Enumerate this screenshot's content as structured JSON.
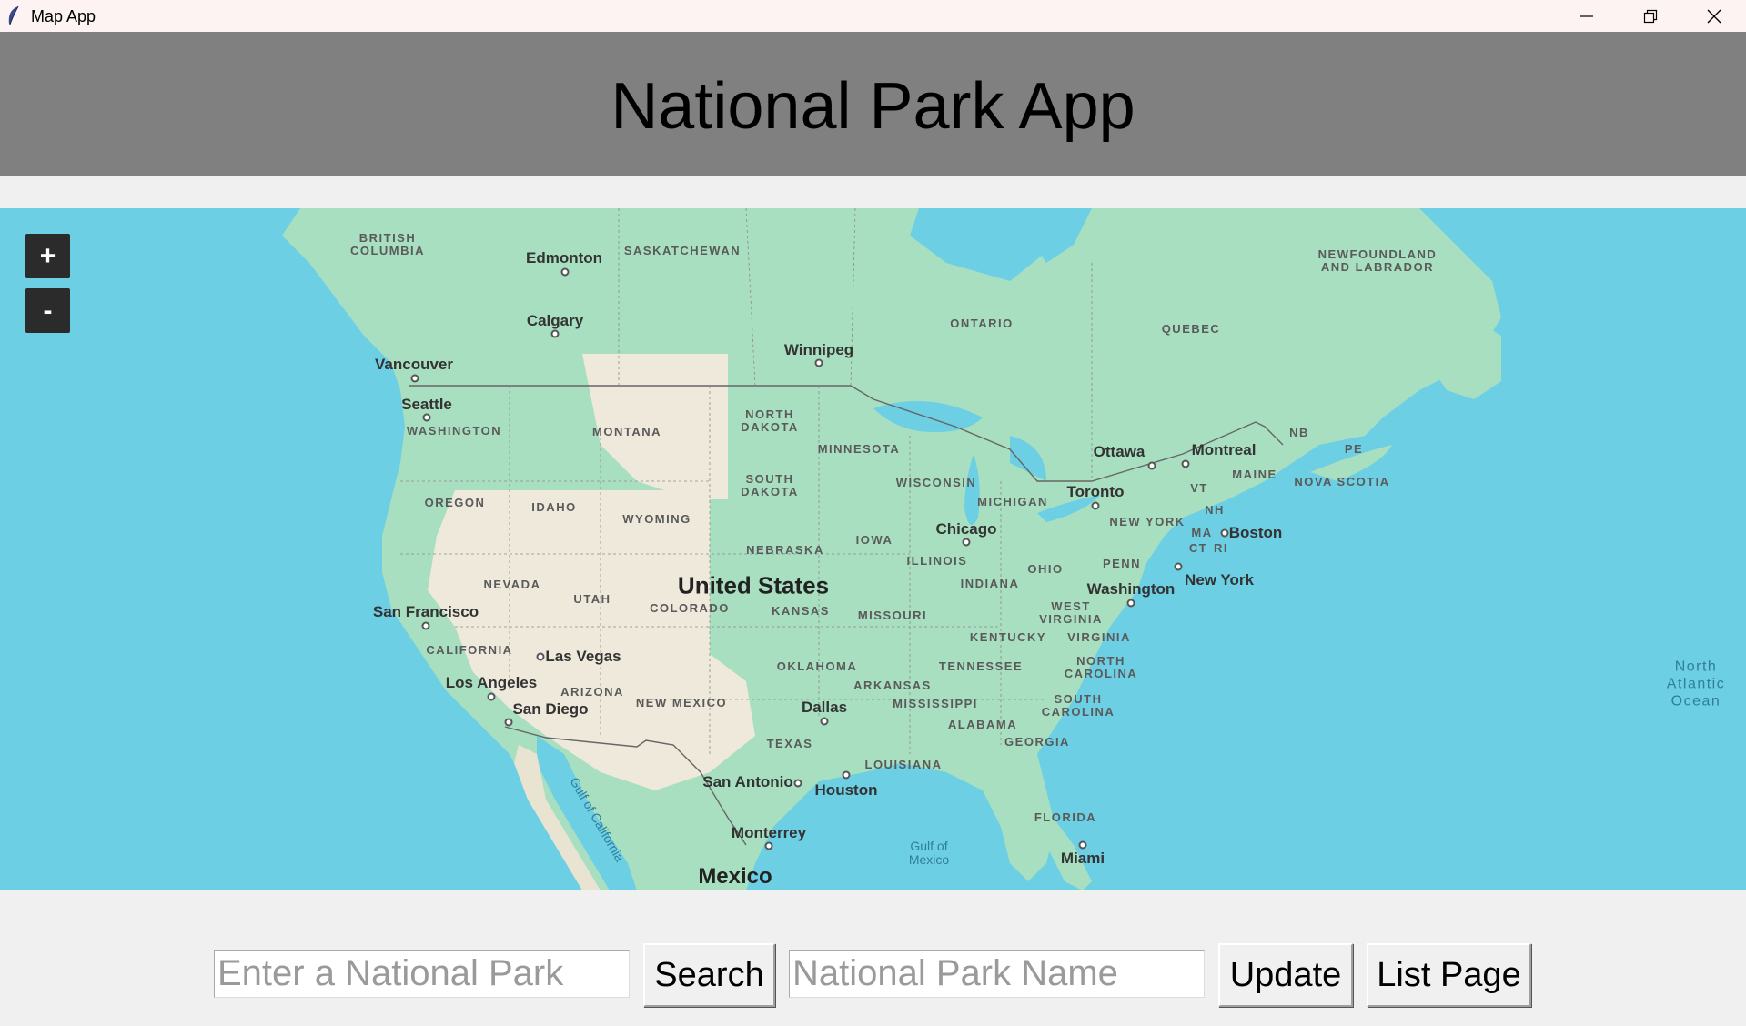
{
  "window": {
    "title": "Map App",
    "controls": [
      "minimize",
      "restore",
      "close"
    ]
  },
  "header": {
    "title": "National Park App",
    "background": "#808080"
  },
  "map": {
    "zoom_in_label": "+",
    "zoom_out_label": "-",
    "labels": {
      "british_columbia": "BRITISH\nCOLUMBIA",
      "edmonton": "Edmonton",
      "saskatchewan": "SASKATCHEWAN",
      "calgary": "Calgary",
      "winnipeg": "Winnipeg",
      "ontario": "ONTARIO",
      "quebec": "QUEBEC",
      "newfoundland": "NEWFOUNDLAND\nAND LABRADOR",
      "vancouver": "Vancouver",
      "seattle": "Seattle",
      "washington": "WASHINGTON",
      "montana": "MONTANA",
      "north_dakota": "NORTH\nDAKOTA",
      "minnesota": "MINNESOTA",
      "ottawa": "Ottawa",
      "montreal": "Montreal",
      "nb": "NB",
      "pe": "PE",
      "oregon": "OREGON",
      "idaho": "IDAHO",
      "south_dakota": "SOUTH\nDAKOTA",
      "wisconsin": "WISCONSIN",
      "michigan": "MICHIGAN",
      "toronto": "Toronto",
      "vt": "VT",
      "maine": "MAINE",
      "nova_scotia": "NOVA SCOTIA",
      "wyoming": "WYOMING",
      "new_york_state": "NEW YORK",
      "nh": "NH",
      "chicago": "Chicago",
      "iowa": "IOWA",
      "nebraska": "NEBRASKA",
      "ma": "MA",
      "boston": "Boston",
      "ct": "CT",
      "ri": "RI",
      "nevada": "NEVADA",
      "illinois": "ILLINOIS",
      "ohio": "OHIO",
      "penn": "PENN",
      "utah": "UTAH",
      "united_states": "United States",
      "indiana": "INDIANA",
      "new_york_city": "New York",
      "washington_dc": "Washington",
      "san_francisco": "San Francisco",
      "colorado": "COLORADO",
      "kansas": "KANSAS",
      "missouri": "MISSOURI",
      "west_virginia": "WEST\nVIRGINIA",
      "kentucky": "KENTUCKY",
      "virginia": "VIRGINIA",
      "california": "CALIFORNIA",
      "las_vegas": "Las Vegas",
      "oklahoma": "OKLAHOMA",
      "tennessee": "TENNESSEE",
      "north_carolina": "NORTH\nCAROLINA",
      "los_angeles": "Los Angeles",
      "arizona": "ARIZONA",
      "arkansas": "ARKANSAS",
      "north_atlantic": "North\nAtlantic\nOcean",
      "san_diego": "San Diego",
      "new_mexico": "NEW MEXICO",
      "dallas": "Dallas",
      "mississippi": "MISSISSIPPI",
      "south_carolina": "SOUTH\nCAROLINA",
      "alabama": "ALABAMA",
      "georgia": "GEORGIA",
      "texas": "TEXAS",
      "louisiana": "LOUISIANA",
      "san_antonio": "San Antonio",
      "houston": "Houston",
      "gulf_of_california": "Gulf of California",
      "florida": "FLORIDA",
      "monterrey": "Monterrey",
      "gulf_of_mexico": "Gulf of\nMexico",
      "miami": "Miami",
      "mexico": "Mexico"
    }
  },
  "search": {
    "placeholder": "Enter a National Park",
    "button_label": "Search"
  },
  "update": {
    "placeholder": "National Park Name",
    "button_label": "Update"
  },
  "list_page": {
    "button_label": "List Page"
  },
  "colors": {
    "water": "#6ccfe4",
    "land": "#a8dfc0",
    "desert": "#efe9dc",
    "window_bg": "#f0f0f0"
  }
}
